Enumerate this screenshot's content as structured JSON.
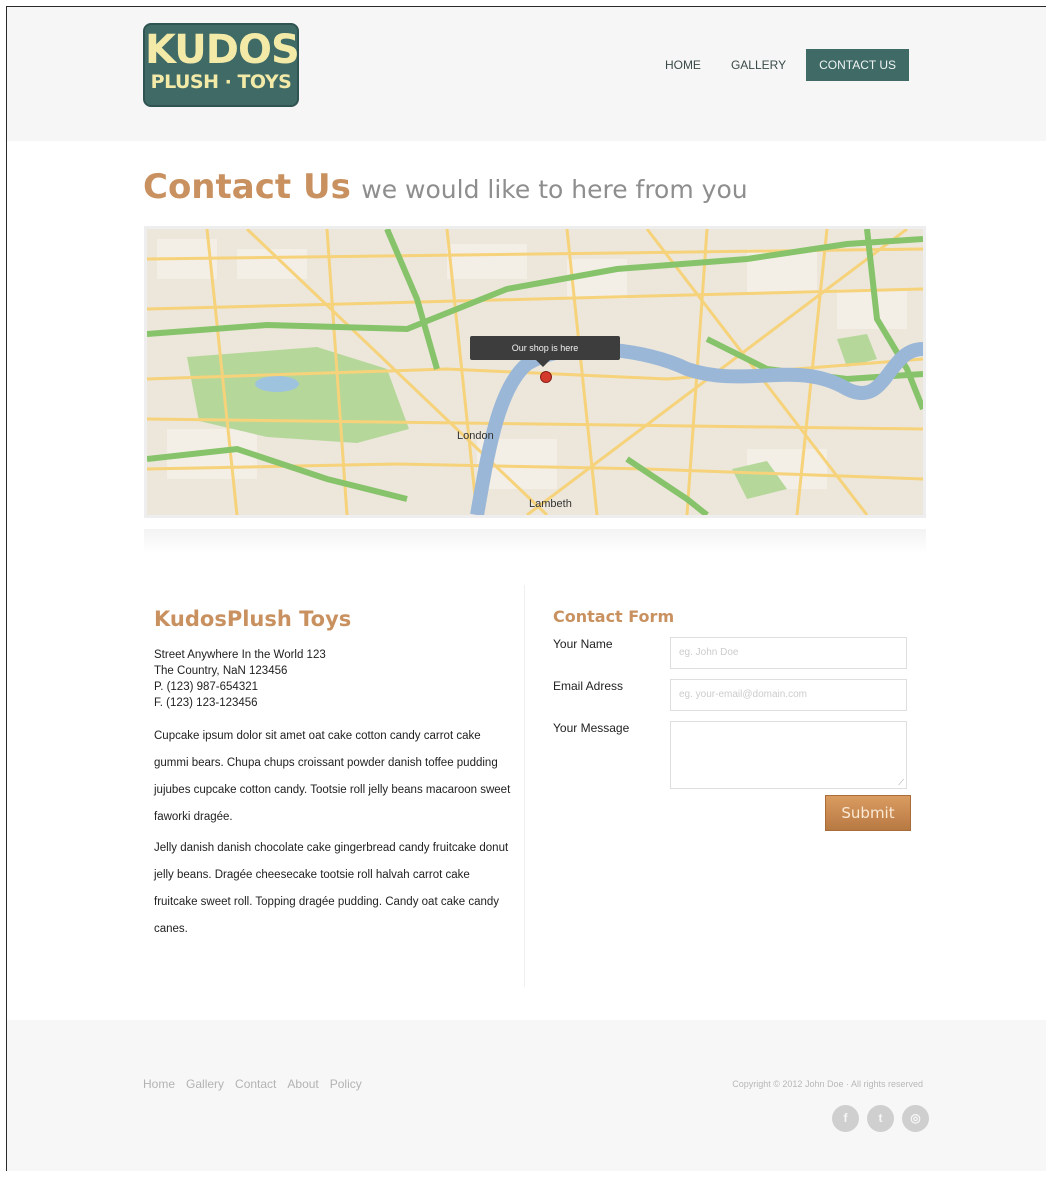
{
  "logo": {
    "line1": "KUDOS",
    "line2": "PLUSH · TOYS"
  },
  "nav": {
    "items": [
      {
        "label": "HOME"
      },
      {
        "label": "GALLERY"
      },
      {
        "label": "CONTACT US"
      }
    ]
  },
  "page": {
    "title": "Contact Us",
    "subtitle": "we would like to here from you"
  },
  "map": {
    "tooltip": "Our shop is here",
    "labels": [
      "London",
      "Lambeth"
    ]
  },
  "company": {
    "name": "KudosPlush Toys",
    "address": [
      "Street Anywhere In the World 123",
      "The Country, NaN 123456",
      "P. (123) 987-654321",
      "F. (123) 123-123456"
    ],
    "paragraphs": [
      "Cupcake ipsum dolor sit amet oat cake cotton candy carrot cake gummi bears. Chupa chups croissant powder danish toffee pudding jujubes cupcake cotton candy. Tootsie roll jelly beans macaroon sweet faworki dragée.",
      "Jelly danish danish chocolate cake gingerbread candy fruitcake donut jelly beans. Dragée cheesecake tootsie roll halvah carrot cake fruitcake sweet roll. Topping dragée pudding. Candy oat cake candy canes."
    ]
  },
  "form": {
    "title": "Contact Form",
    "name_label": "Your Name",
    "name_placeholder": "eg. John Doe",
    "email_label": "Email Adress",
    "email_placeholder": "eg. your-email@domain.com",
    "message_label": "Your Message",
    "submit_label": "Submit"
  },
  "footer": {
    "links": [
      "Home",
      "Gallery",
      "Contact",
      "About",
      "Policy"
    ],
    "copyright": "Copyright © 2012 John Doe · All rights reserved",
    "social": [
      {
        "icon": "facebook-icon",
        "glyph": "f"
      },
      {
        "icon": "twitter-icon",
        "glyph": "t"
      },
      {
        "icon": "rss-icon",
        "glyph": "◎"
      }
    ]
  },
  "colors": {
    "accent": "#c8915f",
    "brand": "#3f6a66",
    "logo_text": "#f3eaa8"
  }
}
